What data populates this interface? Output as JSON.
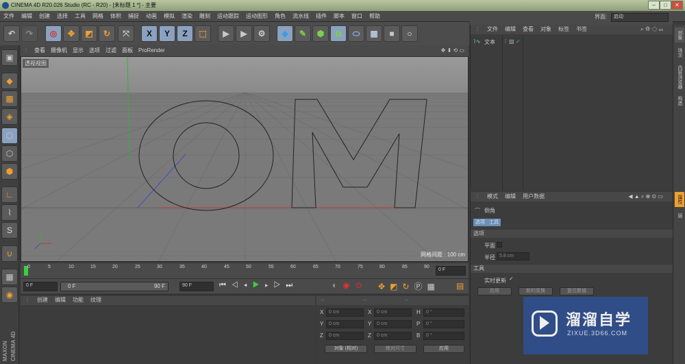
{
  "titlebar": {
    "title": "CINEMA 4D R20.026 Studio (RC - R20) - [未标题 1 *] - 主要",
    "min": "–",
    "max": "□",
    "close": "✕"
  },
  "menu": [
    "文件",
    "编辑",
    "创建",
    "选择",
    "工具",
    "网格",
    "体积",
    "捕捉",
    "动画",
    "模拟",
    "渲染",
    "雕刻",
    "运动跟踪",
    "运动图形",
    "角色",
    "流水线",
    "插件",
    "脚本",
    "窗口",
    "帮助"
  ],
  "layout": {
    "label": "界面:",
    "value": "启动"
  },
  "viewport": {
    "menu": [
      "查看",
      "摄像机",
      "显示",
      "选项",
      "过滤",
      "面板",
      "ProRender"
    ],
    "view_name": "透视视图",
    "grid_spacing": "网格间距 : 100 cm",
    "scene_text": "OM"
  },
  "timeline": {
    "ticks": [
      "0",
      "5",
      "10",
      "15",
      "20",
      "25",
      "30",
      "35",
      "40",
      "45",
      "50",
      "55",
      "60",
      "65",
      "70",
      "75",
      "80",
      "85",
      "90"
    ],
    "current_frame": "0 F"
  },
  "transport": {
    "start": "0 F",
    "range_start": "0 F",
    "range_end": "90 F",
    "end": "90 F"
  },
  "materials": {
    "menu": [
      "创建",
      "编辑",
      "功能",
      "纹理"
    ]
  },
  "coords": {
    "headers": [
      "--",
      "--",
      "--"
    ],
    "rows": [
      {
        "a": "X",
        "av": "0 cm",
        "b": "X",
        "bv": "0 cm",
        "c": "H",
        "cv": "0 °"
      },
      {
        "a": "Y",
        "av": "0 cm",
        "b": "Y",
        "bv": "0 cm",
        "c": "P",
        "cv": "0 °"
      },
      {
        "a": "Z",
        "av": "0 cm",
        "b": "Z",
        "bv": "0 cm",
        "c": "B",
        "cv": "0 °"
      }
    ],
    "mode": "对象 (相对)",
    "size_mode": "绝对尺寸",
    "apply": "应用"
  },
  "objects": {
    "menu": [
      "文件",
      "编辑",
      "查看",
      "对象",
      "标签",
      "书签"
    ],
    "item": "文本"
  },
  "attributes": {
    "menu": [
      "模式",
      "编辑",
      "用户数据"
    ],
    "title": "倒角",
    "tabs": [
      "选项",
      "工具"
    ],
    "section_options": "选项",
    "plane_label": "平面",
    "radius_label": "半径",
    "radius_value": "5.8 cm",
    "section_tool": "工具",
    "realtime_label": "实时更新",
    "btn_apply": "应用",
    "btn_new": "新的变换",
    "btn_reset": "复位数值"
  },
  "right_rail": [
    "对象",
    "场次",
    "内容浏览器",
    "构造",
    "属性",
    "层"
  ],
  "watermark": {
    "brand": "溜溜自学",
    "url": "ZIXUE.3D66.COM"
  },
  "side_logo": {
    "line1": "MAXON",
    "line2": "CINEMA 4D"
  },
  "colors": {
    "accent_blue": "#8aa2bf",
    "x_axis": "#c0392b",
    "y_axis": "#3faa3f",
    "z_axis": "#3f4fc0",
    "watermark_bg": "#2f4f8f"
  }
}
